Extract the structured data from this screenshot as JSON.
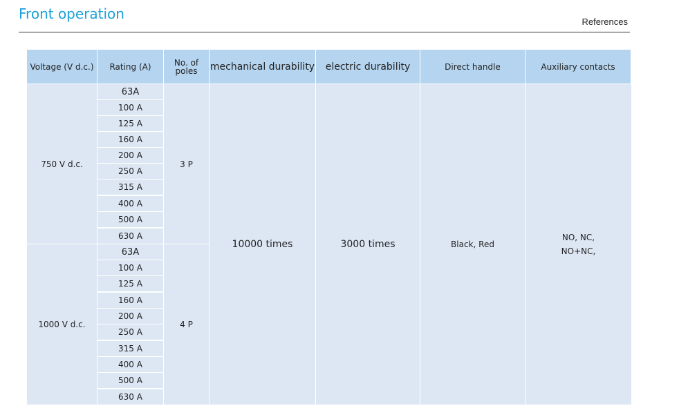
{
  "page": {
    "title": "Front operation",
    "references": "References"
  },
  "headers": {
    "voltage": "Voltage (V d.c.)",
    "rating": "Rating (A)",
    "poles_line1": "No. of",
    "poles_line2": "poles",
    "mechanical": "mechanical durability",
    "electric": "electric durability",
    "handle": "Direct handle",
    "aux": "Auxiliary contacts"
  },
  "groups": [
    {
      "voltage": "750 V d.c.",
      "poles": "3 P",
      "ratings": [
        "63A",
        "100 A",
        "125 A",
        "160 A",
        "200 A",
        "250 A",
        "315 A",
        "400 A",
        "500 A",
        "630 A"
      ]
    },
    {
      "voltage": "1000 V d.c.",
      "poles": "4 P",
      "ratings": [
        "63A",
        "100 A",
        "125 A",
        "160 A",
        "200 A",
        "250 A",
        "315 A",
        "400 A",
        "500 A",
        "630 A"
      ]
    }
  ],
  "shared": {
    "mechanical": "10000 times",
    "electric": "3000 times",
    "handle": "Black, Red",
    "aux_line1": "NO, NC,",
    "aux_line2": "NO+NC,"
  },
  "colors": {
    "title": "#1aa0d8",
    "header_bg": "#b5d4ef",
    "cell_bg": "#dde7f4"
  }
}
